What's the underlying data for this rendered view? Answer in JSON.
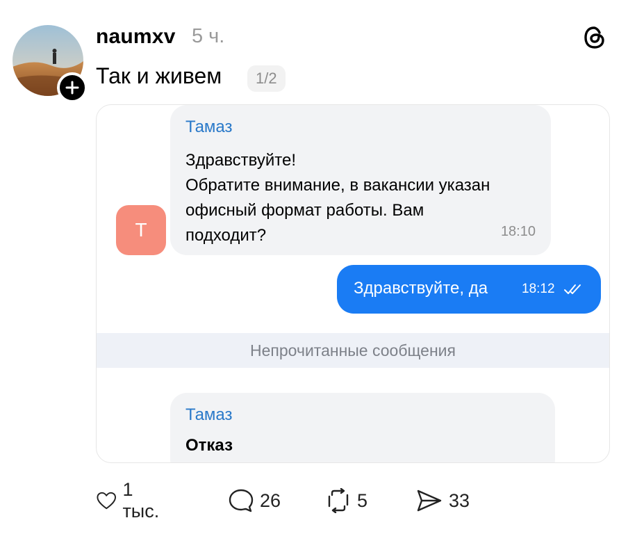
{
  "post": {
    "username": "naumxv",
    "time": "5 ч.",
    "text": "Так и живем",
    "image_counter": "1/2"
  },
  "chat": {
    "message1": {
      "sender": "Тамаз",
      "avatar_letter": "Т",
      "lines": [
        "Здравствуйте!",
        "Обратите внимание, в вакансии указан",
        "офисный формат работы. Вам",
        "подходит?"
      ],
      "time": "18:10"
    },
    "reply": {
      "text": "Здравствуйте, да",
      "time": "18:12"
    },
    "unread_label": "Непрочитанные сообщения",
    "message2": {
      "sender": "Тамаз",
      "text": "Отказ"
    }
  },
  "actions": {
    "likes": "1 тыс.",
    "comments": "26",
    "reposts": "5",
    "shares": "33"
  },
  "colors": {
    "outgoing_bubble": "#1a7cf4",
    "incoming_bubble": "#f2f3f5",
    "sender_name": "#2a79c9",
    "avatar_tile": "#f68d7c"
  }
}
